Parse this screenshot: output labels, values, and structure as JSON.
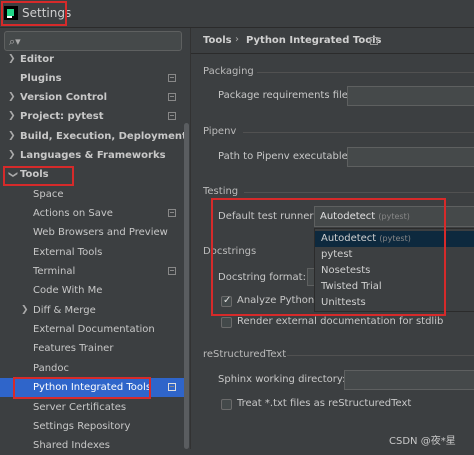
{
  "window": {
    "title": "Settings"
  },
  "search": {
    "placeholder": "",
    "icon": "search-icon"
  },
  "sidebar": {
    "items": [
      {
        "label": "Editor",
        "expandable": true
      },
      {
        "label": "Plugins",
        "expandable": false
      },
      {
        "label": "Version Control",
        "expandable": true
      },
      {
        "label": "Project: pytest",
        "expandable": true
      },
      {
        "label": "Build, Execution, Deployment",
        "expandable": true
      },
      {
        "label": "Languages & Frameworks",
        "expandable": true
      },
      {
        "label": "Tools",
        "expandable": true,
        "expanded": true
      },
      {
        "label": "Space"
      },
      {
        "label": "Actions on Save"
      },
      {
        "label": "Web Browsers and Preview"
      },
      {
        "label": "External Tools"
      },
      {
        "label": "Terminal"
      },
      {
        "label": "Code With Me"
      },
      {
        "label": "Diff & Merge",
        "expandable": true
      },
      {
        "label": "External Documentation"
      },
      {
        "label": "Features Trainer"
      },
      {
        "label": "Pandoc"
      },
      {
        "label": "Python Integrated Tools",
        "selected": true
      },
      {
        "label": "Server Certificates"
      },
      {
        "label": "Settings Repository"
      },
      {
        "label": "Shared Indexes"
      }
    ]
  },
  "breadcrumb": {
    "parent": "Tools",
    "sep": "›",
    "current": "Python Integrated Tools"
  },
  "packaging": {
    "section": "Packaging",
    "requirements_label": "Package requirements file:"
  },
  "pipenv": {
    "section": "Pipenv",
    "path_label": "Path to Pipenv executable:"
  },
  "testing": {
    "section": "Testing",
    "runner_label": "Default test runner:",
    "runner_value": "Autodetect",
    "runner_hint": "(pytest)",
    "options": [
      {
        "label": "Autodetect",
        "hint": "(pytest)",
        "selected": true
      },
      {
        "label": "pytest"
      },
      {
        "label": "Nosetests"
      },
      {
        "label": "Twisted Trial"
      },
      {
        "label": "Unittests"
      }
    ]
  },
  "docstrings": {
    "section": "Docstrings",
    "format_label": "Docstring format:",
    "analyze_label": "Analyze Python c",
    "analyze_checked": true,
    "render_label": "Render external documentation for stdlib",
    "render_checked": false
  },
  "rst": {
    "section": "reStructuredText",
    "sphinx_label": "Sphinx working directory:",
    "txt_label": "Treat *.txt files as reStructuredText",
    "txt_checked": false
  },
  "watermark": "CSDN @夜*星",
  "colors": {
    "selection": "#2f65ca",
    "highlight_box": "#d62a2a",
    "background": "#3c3f41"
  }
}
